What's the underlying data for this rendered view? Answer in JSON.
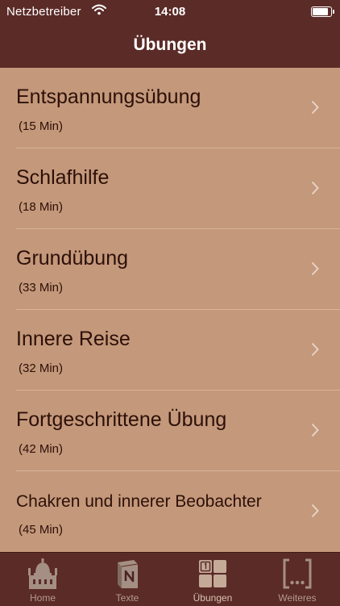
{
  "status_bar": {
    "carrier": "Netzbetreiber",
    "time": "14:08",
    "battery_level": 0.95
  },
  "header": {
    "title": "Übungen"
  },
  "exercises": [
    {
      "title": "Entspannungsübung",
      "duration": "(15 Min)"
    },
    {
      "title": "Schlafhilfe",
      "duration": "(18 Min)"
    },
    {
      "title": "Grundübung",
      "duration": "(33 Min)"
    },
    {
      "title": "Innere Reise",
      "duration": "(32 Min)"
    },
    {
      "title": "Fortgeschrittene Übung",
      "duration": "(42 Min)"
    },
    {
      "title": "Chakren und innerer Beobachter",
      "duration": "(45 Min)"
    }
  ],
  "tabbar": {
    "active": "Übungen",
    "tabs": [
      {
        "label": "Home",
        "icon": "cathedral-icon"
      },
      {
        "label": "Texte",
        "icon": "book-icon"
      },
      {
        "label": "Übungen",
        "icon": "exercises-grid-icon"
      },
      {
        "label": "Weiteres",
        "icon": "more-brackets-icon"
      }
    ]
  },
  "colors": {
    "bar_bg": "#5b2b28",
    "list_bg": "#c4987a",
    "text_dark": "#2c1009",
    "tab_icon": "#a58f84"
  }
}
